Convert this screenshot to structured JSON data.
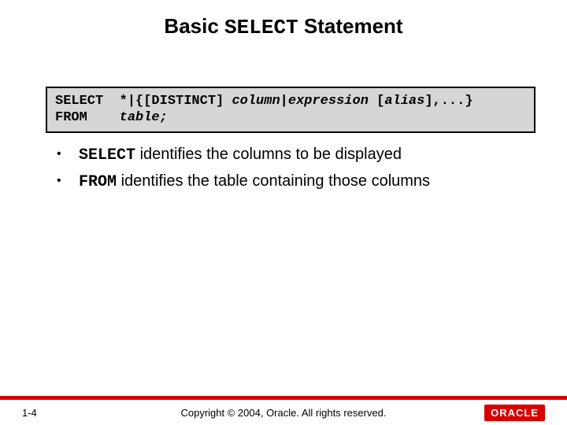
{
  "title": {
    "prefix": "Basic ",
    "keyword": "SELECT",
    "suffix": " Statement"
  },
  "syntax": {
    "line1": {
      "kw1": "SELECT",
      "lit1": "  *|{[DISTINCT] ",
      "it1": "column",
      "lit2": "|",
      "it2": "expression",
      "lit3": " [",
      "it3": "alias",
      "lit4": "],...}"
    },
    "line2": {
      "kw1": "FROM",
      "pad": "    ",
      "it1": "table;"
    }
  },
  "bullets": [
    {
      "dot": "•",
      "code": "SELECT",
      "rest": " identifies the columns to be displayed"
    },
    {
      "dot": "•",
      "code": "FROM",
      "rest": " identifies the table containing those columns"
    }
  ],
  "footer": {
    "page": "1-4",
    "copyright": "Copyright © 2004, Oracle.  All rights reserved.",
    "logo": "ORACLE"
  }
}
